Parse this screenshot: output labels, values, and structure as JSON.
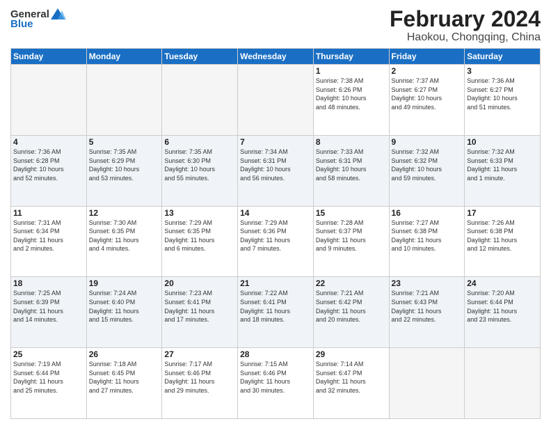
{
  "logo": {
    "general": "General",
    "blue": "Blue"
  },
  "title": {
    "month": "February 2024",
    "location": "Haokou, Chongqing, China"
  },
  "weekdays": [
    "Sunday",
    "Monday",
    "Tuesday",
    "Wednesday",
    "Thursday",
    "Friday",
    "Saturday"
  ],
  "weeks": [
    [
      {
        "day": "",
        "info": ""
      },
      {
        "day": "",
        "info": ""
      },
      {
        "day": "",
        "info": ""
      },
      {
        "day": "",
        "info": ""
      },
      {
        "day": "1",
        "info": "Sunrise: 7:38 AM\nSunset: 6:26 PM\nDaylight: 10 hours\nand 48 minutes."
      },
      {
        "day": "2",
        "info": "Sunrise: 7:37 AM\nSunset: 6:27 PM\nDaylight: 10 hours\nand 49 minutes."
      },
      {
        "day": "3",
        "info": "Sunrise: 7:36 AM\nSunset: 6:27 PM\nDaylight: 10 hours\nand 51 minutes."
      }
    ],
    [
      {
        "day": "4",
        "info": "Sunrise: 7:36 AM\nSunset: 6:28 PM\nDaylight: 10 hours\nand 52 minutes."
      },
      {
        "day": "5",
        "info": "Sunrise: 7:35 AM\nSunset: 6:29 PM\nDaylight: 10 hours\nand 53 minutes."
      },
      {
        "day": "6",
        "info": "Sunrise: 7:35 AM\nSunset: 6:30 PM\nDaylight: 10 hours\nand 55 minutes."
      },
      {
        "day": "7",
        "info": "Sunrise: 7:34 AM\nSunset: 6:31 PM\nDaylight: 10 hours\nand 56 minutes."
      },
      {
        "day": "8",
        "info": "Sunrise: 7:33 AM\nSunset: 6:31 PM\nDaylight: 10 hours\nand 58 minutes."
      },
      {
        "day": "9",
        "info": "Sunrise: 7:32 AM\nSunset: 6:32 PM\nDaylight: 10 hours\nand 59 minutes."
      },
      {
        "day": "10",
        "info": "Sunrise: 7:32 AM\nSunset: 6:33 PM\nDaylight: 11 hours\nand 1 minute."
      }
    ],
    [
      {
        "day": "11",
        "info": "Sunrise: 7:31 AM\nSunset: 6:34 PM\nDaylight: 11 hours\nand 2 minutes."
      },
      {
        "day": "12",
        "info": "Sunrise: 7:30 AM\nSunset: 6:35 PM\nDaylight: 11 hours\nand 4 minutes."
      },
      {
        "day": "13",
        "info": "Sunrise: 7:29 AM\nSunset: 6:35 PM\nDaylight: 11 hours\nand 6 minutes."
      },
      {
        "day": "14",
        "info": "Sunrise: 7:29 AM\nSunset: 6:36 PM\nDaylight: 11 hours\nand 7 minutes."
      },
      {
        "day": "15",
        "info": "Sunrise: 7:28 AM\nSunset: 6:37 PM\nDaylight: 11 hours\nand 9 minutes."
      },
      {
        "day": "16",
        "info": "Sunrise: 7:27 AM\nSunset: 6:38 PM\nDaylight: 11 hours\nand 10 minutes."
      },
      {
        "day": "17",
        "info": "Sunrise: 7:26 AM\nSunset: 6:38 PM\nDaylight: 11 hours\nand 12 minutes."
      }
    ],
    [
      {
        "day": "18",
        "info": "Sunrise: 7:25 AM\nSunset: 6:39 PM\nDaylight: 11 hours\nand 14 minutes."
      },
      {
        "day": "19",
        "info": "Sunrise: 7:24 AM\nSunset: 6:40 PM\nDaylight: 11 hours\nand 15 minutes."
      },
      {
        "day": "20",
        "info": "Sunrise: 7:23 AM\nSunset: 6:41 PM\nDaylight: 11 hours\nand 17 minutes."
      },
      {
        "day": "21",
        "info": "Sunrise: 7:22 AM\nSunset: 6:41 PM\nDaylight: 11 hours\nand 18 minutes."
      },
      {
        "day": "22",
        "info": "Sunrise: 7:21 AM\nSunset: 6:42 PM\nDaylight: 11 hours\nand 20 minutes."
      },
      {
        "day": "23",
        "info": "Sunrise: 7:21 AM\nSunset: 6:43 PM\nDaylight: 11 hours\nand 22 minutes."
      },
      {
        "day": "24",
        "info": "Sunrise: 7:20 AM\nSunset: 6:44 PM\nDaylight: 11 hours\nand 23 minutes."
      }
    ],
    [
      {
        "day": "25",
        "info": "Sunrise: 7:19 AM\nSunset: 6:44 PM\nDaylight: 11 hours\nand 25 minutes."
      },
      {
        "day": "26",
        "info": "Sunrise: 7:18 AM\nSunset: 6:45 PM\nDaylight: 11 hours\nand 27 minutes."
      },
      {
        "day": "27",
        "info": "Sunrise: 7:17 AM\nSunset: 6:46 PM\nDaylight: 11 hours\nand 29 minutes."
      },
      {
        "day": "28",
        "info": "Sunrise: 7:15 AM\nSunset: 6:46 PM\nDaylight: 11 hours\nand 30 minutes."
      },
      {
        "day": "29",
        "info": "Sunrise: 7:14 AM\nSunset: 6:47 PM\nDaylight: 11 hours\nand 32 minutes."
      },
      {
        "day": "",
        "info": ""
      },
      {
        "day": "",
        "info": ""
      }
    ]
  ]
}
